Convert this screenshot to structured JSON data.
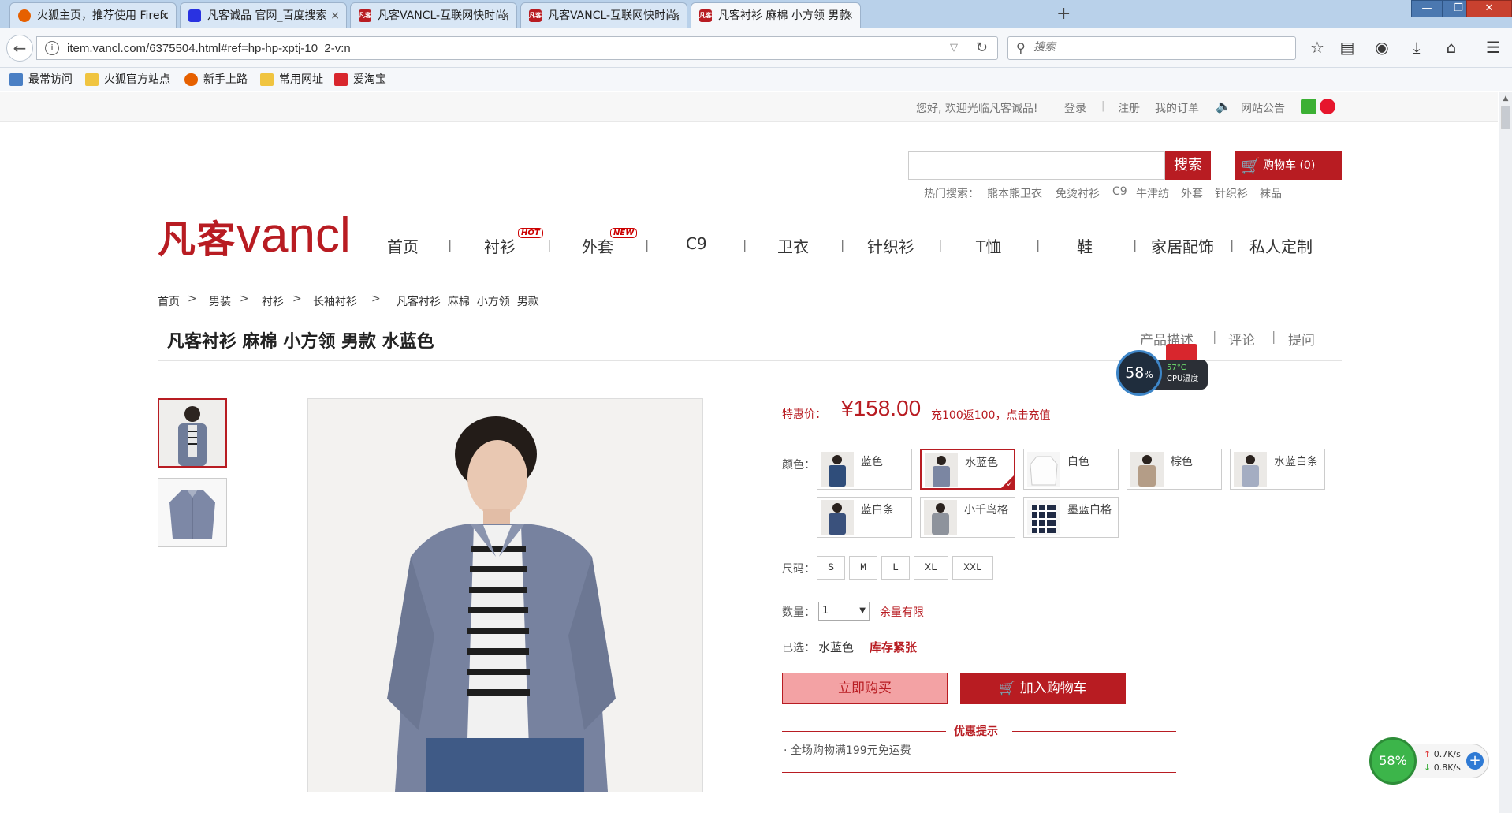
{
  "browser": {
    "tabs": [
      {
        "title": "火狐主页，推荐使用 Firefox",
        "icon": "firefox-icon",
        "icon_color": "#e66000"
      },
      {
        "title": "凡客诚品 官网_百度搜索",
        "icon": "baidu-paw-icon",
        "icon_color": "#2932e1"
      },
      {
        "title": "凡客VANCL-互联网快时尚品",
        "icon": "vancl-icon",
        "icon_color": "#b81c22"
      },
      {
        "title": "凡客VANCL-互联网快时尚品",
        "icon": "vancl-icon",
        "icon_color": "#b81c22"
      },
      {
        "title": "凡客衬衫 麻棉 小方领 男款 水",
        "icon": "vancl-icon",
        "icon_color": "#b81c22"
      }
    ],
    "tab_close": "×",
    "new_tab": "+",
    "favicon_text": "凡客",
    "url": "item.vancl.com/6375504.html#ref=hp-hp-xptj-10_2-v:n",
    "search_placeholder": "搜索",
    "bookmarks": [
      {
        "label": "最常访问",
        "color": "#4a7fc4"
      },
      {
        "label": "火狐官方站点",
        "color": "#f0c440"
      },
      {
        "label": "新手上路",
        "color": "#e66000"
      },
      {
        "label": "常用网址",
        "color": "#f0c440"
      },
      {
        "label": "爱淘宝",
        "color": "#d8262d"
      }
    ]
  },
  "top_strip": {
    "welcome": "您好, 欢迎光临凡客诚品!",
    "login": "登录",
    "register": "注册",
    "orders": "我的订单",
    "notice": "网站公告"
  },
  "site_search": {
    "button": "搜索",
    "cart": "购物车 (0)",
    "hot_label": "热门搜索：",
    "hot_items": [
      "熊本熊卫衣",
      "免烫衬衫",
      "C9",
      "牛津纺",
      "外套",
      "针织衫",
      "袜品"
    ]
  },
  "logo": {
    "cn": "凡客",
    "en": "vancl"
  },
  "main_nav": [
    {
      "label": "首页"
    },
    {
      "label": "衬衫",
      "badge": "HOT"
    },
    {
      "label": "外套",
      "badge": "NEW"
    },
    {
      "label": "C9"
    },
    {
      "label": "卫衣"
    },
    {
      "label": "针织衫"
    },
    {
      "label": "T恤"
    },
    {
      "label": "鞋"
    },
    {
      "label": "家居配饰"
    },
    {
      "label": "私人定制"
    }
  ],
  "breadcrumb": [
    "首页",
    "男装",
    "衬衫",
    "长袖衬衫",
    "凡客衬衫  麻棉  小方领  男款"
  ],
  "product": {
    "title": "凡客衬衫 麻棉 小方领 男款 水蓝色",
    "tabs": [
      "产品描述",
      "评论",
      "提问"
    ],
    "price_label": "特惠价：",
    "price": "¥158.00",
    "promo": "充100返100，点击充值",
    "color_label": "颜色：",
    "colors": [
      {
        "name": "蓝色",
        "selected": false
      },
      {
        "name": "水蓝色",
        "selected": true
      },
      {
        "name": "白色",
        "selected": false
      },
      {
        "name": "棕色",
        "selected": false
      },
      {
        "name": "水蓝白条",
        "selected": false
      },
      {
        "name": "蓝白条",
        "selected": false
      },
      {
        "name": "小千鸟格",
        "selected": false
      },
      {
        "name": "墨蓝白格",
        "selected": false
      }
    ],
    "size_label": "尺码：",
    "sizes": [
      "S",
      "M",
      "L",
      "XL",
      "XXL"
    ],
    "qty_label": "数量：",
    "qty_value": "1",
    "stock_note": "余量有限",
    "selected_label": "已选：",
    "selected_color": "水蓝色",
    "selected_stock": "库存紧张",
    "buy_now": "立即购买",
    "add_cart": "加入购物车",
    "promo_title": "优惠提示",
    "promo_items": [
      "全场购物满199元免运费"
    ]
  },
  "widgets": {
    "cpu_percent": "58",
    "cpu_unit": "%",
    "cpu_temp": "57°C",
    "cpu_label": "CPU温度",
    "net_percent": "58%",
    "net_up": "0.7K/s",
    "net_down": "0.8K/s"
  },
  "colors": {
    "brand_red": "#b81c22",
    "light_red": "#f3a2a4"
  }
}
